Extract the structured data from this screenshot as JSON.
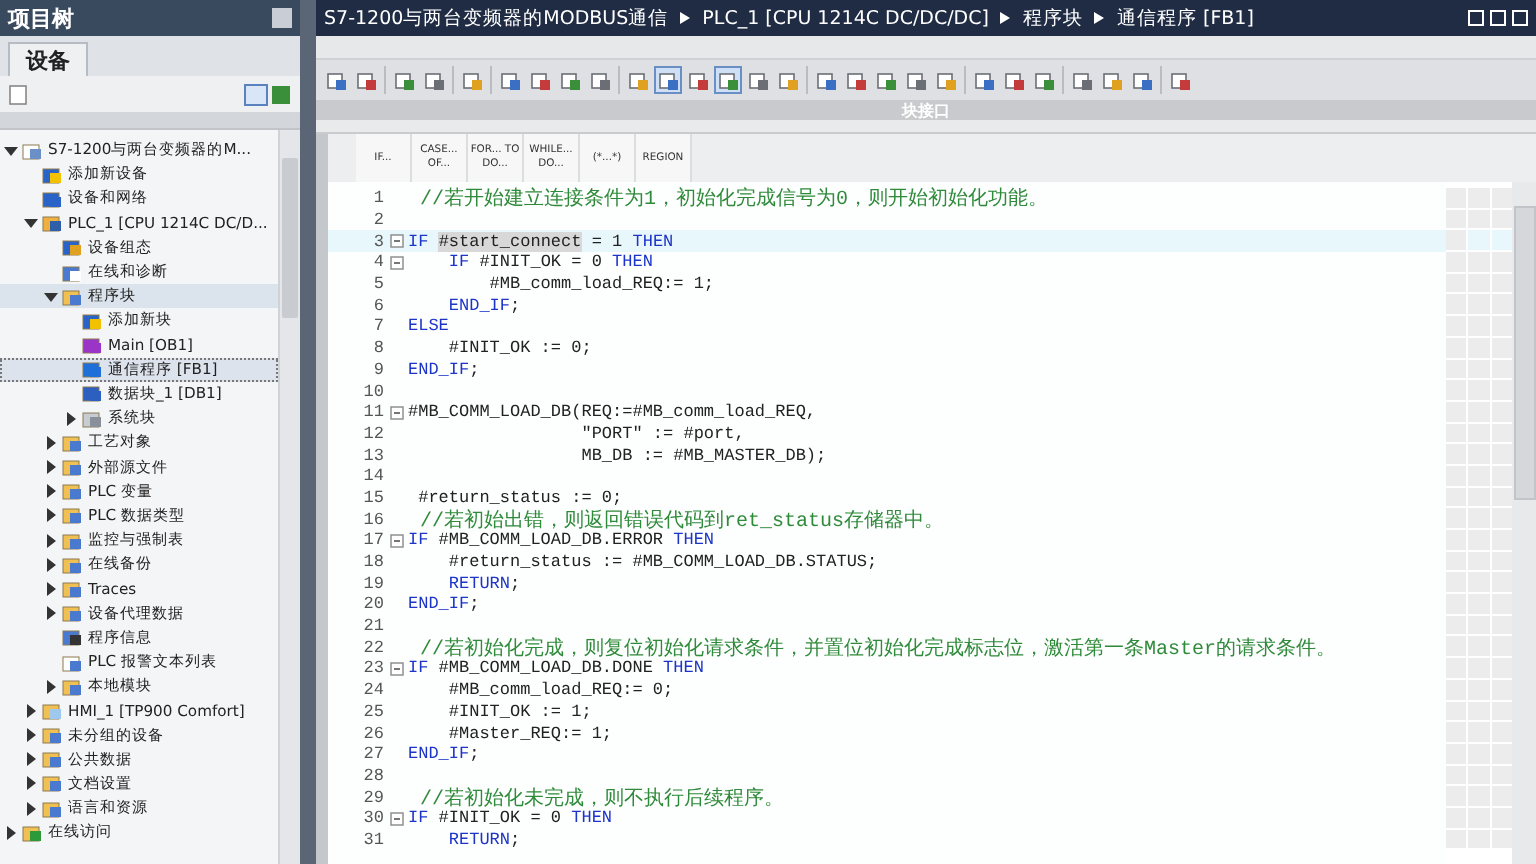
{
  "project_tree": {
    "title": "项目树",
    "tab": {
      "label": "设备",
      "selected": true
    },
    "items": [
      {
        "label": "S7-1200与两台变频器的M...",
        "kind": "project",
        "expanded": true,
        "selected": false,
        "children": [
          {
            "label": "添加新设备",
            "kind": "add",
            "selected": false
          },
          {
            "label": "设备和网络",
            "kind": "network",
            "selected": false
          },
          {
            "label": "PLC_1 [CPU 1214C DC/D...",
            "kind": "plc",
            "expanded": true,
            "selected": false,
            "children": [
              {
                "label": "设备组态",
                "kind": "config",
                "selected": false
              },
              {
                "label": "在线和诊断",
                "kind": "diag",
                "selected": false
              },
              {
                "label": "程序块",
                "kind": "folder",
                "expanded": true,
                "selected": false,
                "hover": true,
                "children": [
                  {
                    "label": "添加新块",
                    "kind": "add",
                    "selected": false
                  },
                  {
                    "label": "Main [OB1]",
                    "kind": "ob",
                    "selected": false
                  },
                  {
                    "label": "通信程序 [FB1]",
                    "kind": "fb",
                    "selected": true
                  },
                  {
                    "label": "数据块_1 [DB1]",
                    "kind": "db",
                    "selected": false
                  },
                  {
                    "label": "系统块",
                    "kind": "sysfolder",
                    "expanded": false,
                    "selected": false
                  }
                ]
              },
              {
                "label": "工艺对象",
                "kind": "folder",
                "expanded": false,
                "selected": false
              },
              {
                "label": "外部源文件",
                "kind": "folder",
                "expanded": false,
                "selected": false
              },
              {
                "label": "PLC 变量",
                "kind": "folder",
                "expanded": false,
                "selected": false
              },
              {
                "label": "PLC 数据类型",
                "kind": "folder",
                "expanded": false,
                "selected": false
              },
              {
                "label": "监控与强制表",
                "kind": "folder",
                "expanded": false,
                "selected": false
              },
              {
                "label": "在线备份",
                "kind": "folder",
                "expanded": false,
                "selected": false
              },
              {
                "label": "Traces",
                "kind": "folder",
                "expanded": false,
                "selected": false
              },
              {
                "label": "设备代理数据",
                "kind": "folder",
                "expanded": false,
                "selected": false
              },
              {
                "label": "程序信息",
                "kind": "info",
                "selected": false
              },
              {
                "label": "PLC 报警文本列表",
                "kind": "doc",
                "selected": false
              },
              {
                "label": "本地模块",
                "kind": "folder",
                "expanded": false,
                "selected": false
              }
            ]
          },
          {
            "label": "HMI_1 [TP900 Comfort]",
            "kind": "hmi",
            "expanded": false,
            "selected": false
          },
          {
            "label": "未分组的设备",
            "kind": "folder",
            "expanded": false,
            "selected": false
          },
          {
            "label": "公共数据",
            "kind": "folder",
            "expanded": false,
            "selected": false
          },
          {
            "label": "文档设置",
            "kind": "folder",
            "expanded": false,
            "selected": false
          },
          {
            "label": "语言和资源",
            "kind": "folder",
            "expanded": false,
            "selected": false
          }
        ]
      },
      {
        "label": "在线访问",
        "kind": "online",
        "expanded": false,
        "selected": false
      }
    ]
  },
  "breadcrumb": [
    "S7-1200与两台变频器的MODBUS通信",
    "PLC_1 [CPU 1214C DC/DC/DC]",
    "程序块",
    "通信程序 [FB1]"
  ],
  "interface_bar": {
    "title": "块接口"
  },
  "snippets": [
    "IF...",
    "CASE... OF...",
    "FOR... TO DO...",
    "WHILE... DO...",
    "(*...*)",
    "REGION"
  ],
  "code_lines": [
    {
      "number": "1",
      "fold": false,
      "current": false,
      "segments": [
        {
          "kind": "comment",
          "text": " //若开始建立连接条件为1，初始化完成信号为0，则开始初始化功能。"
        }
      ]
    },
    {
      "number": "2",
      "fold": false,
      "current": false
    },
    {
      "number": "3",
      "fold": true,
      "current": true,
      "segments": [
        {
          "kind": "keyword",
          "text": "IF "
        },
        {
          "kind": "highlight",
          "text": "#start_connect"
        },
        {
          "kind": "code",
          "text": " = 1 "
        },
        {
          "kind": "keyword",
          "text": "THEN"
        }
      ]
    },
    {
      "number": "4",
      "fold": true,
      "current": false,
      "segments": [
        {
          "kind": "keyword",
          "text": "    IF"
        },
        {
          "kind": "code",
          "text": " #INIT_OK = 0 "
        },
        {
          "kind": "keyword",
          "text": "THEN"
        }
      ]
    },
    {
      "number": "5",
      "fold": false,
      "current": false,
      "segments": [
        {
          "kind": "code",
          "text": "        #MB_comm_load_REQ:= 1;"
        }
      ]
    },
    {
      "number": "6",
      "fold": false,
      "current": false,
      "segments": [
        {
          "kind": "keyword",
          "text": "    END_IF"
        },
        {
          "kind": "code",
          "text": ";"
        }
      ]
    },
    {
      "number": "7",
      "fold": false,
      "current": false,
      "segments": [
        {
          "kind": "keyword",
          "text": "ELSE"
        }
      ]
    },
    {
      "number": "8",
      "fold": false,
      "current": false,
      "segments": [
        {
          "kind": "code",
          "text": "    #INIT_OK := 0;"
        }
      ]
    },
    {
      "number": "9",
      "fold": false,
      "current": false,
      "segments": [
        {
          "kind": "keyword",
          "text": "END_IF"
        },
        {
          "kind": "code",
          "text": ";"
        }
      ]
    },
    {
      "number": "10",
      "fold": false,
      "current": false
    },
    {
      "number": "11",
      "fold": true,
      "current": false,
      "segments": [
        {
          "kind": "code",
          "text": "#MB_COMM_LOAD_DB(REQ:=#MB_comm_load_REQ,"
        }
      ]
    },
    {
      "number": "12",
      "fold": false,
      "current": false,
      "segments": [
        {
          "kind": "code",
          "text": "                 \"PORT\" := #port,"
        }
      ]
    },
    {
      "number": "13",
      "fold": false,
      "current": false,
      "segments": [
        {
          "kind": "code",
          "text": "                 MB_DB := #MB_MASTER_DB);"
        }
      ]
    },
    {
      "number": "14",
      "fold": false,
      "current": false
    },
    {
      "number": "15",
      "fold": false,
      "current": false,
      "segments": [
        {
          "kind": "code",
          "text": " #return_status := 0;"
        }
      ]
    },
    {
      "number": "16",
      "fold": false,
      "current": false,
      "segments": [
        {
          "kind": "comment",
          "text": " //若初始出错，则返回错误代码到ret_status存储器中。"
        }
      ]
    },
    {
      "number": "17",
      "fold": true,
      "current": false,
      "segments": [
        {
          "kind": "keyword",
          "text": "IF"
        },
        {
          "kind": "code",
          "text": " #MB_COMM_LOAD_DB.ERROR "
        },
        {
          "kind": "keyword",
          "text": "THEN"
        }
      ]
    },
    {
      "number": "18",
      "fold": false,
      "current": false,
      "segments": [
        {
          "kind": "code",
          "text": "    #return_status := #MB_COMM_LOAD_DB.STATUS;"
        }
      ]
    },
    {
      "number": "19",
      "fold": false,
      "current": false,
      "segments": [
        {
          "kind": "keyword",
          "text": "    RETURN"
        },
        {
          "kind": "code",
          "text": ";"
        }
      ]
    },
    {
      "number": "20",
      "fold": false,
      "current": false,
      "segments": [
        {
          "kind": "keyword",
          "text": "END_IF"
        },
        {
          "kind": "code",
          "text": ";"
        }
      ]
    },
    {
      "number": "21",
      "fold": false,
      "current": false
    },
    {
      "number": "22",
      "fold": false,
      "current": false,
      "segments": [
        {
          "kind": "comment",
          "text": " //若初始化完成，则复位初始化请求条件，并置位初始化完成标志位，激活第一条Master的请求条件。"
        }
      ]
    },
    {
      "number": "23",
      "fold": true,
      "current": false,
      "segments": [
        {
          "kind": "keyword",
          "text": "IF"
        },
        {
          "kind": "code",
          "text": " #MB_COMM_LOAD_DB.DONE "
        },
        {
          "kind": "keyword",
          "text": "THEN"
        }
      ]
    },
    {
      "number": "24",
      "fold": false,
      "current": false,
      "segments": [
        {
          "kind": "code",
          "text": "    #MB_comm_load_REQ:= 0;"
        }
      ]
    },
    {
      "number": "25",
      "fold": false,
      "current": false,
      "segments": [
        {
          "kind": "code",
          "text": "    #INIT_OK := 1;"
        }
      ]
    },
    {
      "number": "26",
      "fold": false,
      "current": false,
      "segments": [
        {
          "kind": "code",
          "text": "    #Master_REQ:= 1;"
        }
      ]
    },
    {
      "number": "27",
      "fold": false,
      "current": false,
      "segments": [
        {
          "kind": "keyword",
          "text": "END_IF"
        },
        {
          "kind": "code",
          "text": ";"
        }
      ]
    },
    {
      "number": "28",
      "fold": false,
      "current": false
    },
    {
      "number": "29",
      "fold": false,
      "current": false,
      "segments": [
        {
          "kind": "comment",
          "text": " //若初始化未完成，则不执行后续程序。"
        }
      ]
    },
    {
      "number": "30",
      "fold": true,
      "current": false,
      "segments": [
        {
          "kind": "keyword",
          "text": "IF"
        },
        {
          "kind": "code",
          "text": " #INIT_OK = 0 "
        },
        {
          "kind": "keyword",
          "text": "THEN"
        }
      ]
    },
    {
      "number": "31",
      "fold": false,
      "current": false,
      "segments": [
        {
          "kind": "keyword",
          "text": "    RETURN"
        },
        {
          "kind": "code",
          "text": ";"
        }
      ]
    }
  ]
}
